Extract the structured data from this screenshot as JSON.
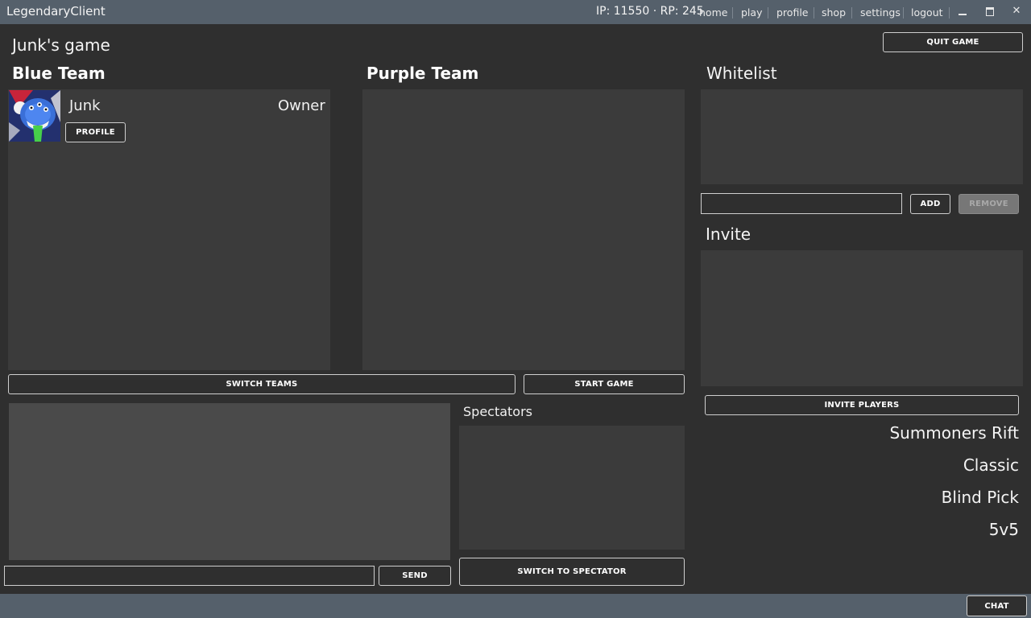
{
  "app": {
    "title": "LegendaryClient"
  },
  "header": {
    "currency": "IP: 11550 · RP: 245",
    "nav": [
      "home",
      "play",
      "profile",
      "shop",
      "settings",
      "logout"
    ],
    "window": {
      "minimize": "",
      "maximize": "",
      "close": "✕"
    }
  },
  "lobby": {
    "title": "Junk's game",
    "quit_label": "QUIT GAME",
    "blue_team": {
      "title": "Blue Team",
      "players": [
        {
          "name": "Junk",
          "role": "Owner",
          "profile_label": "PROFILE"
        }
      ]
    },
    "purple_team": {
      "title": "Purple Team"
    },
    "switch_teams_label": "SWITCH TEAMS",
    "start_game_label": "START GAME"
  },
  "whitelist": {
    "title": "Whitelist",
    "input_value": "",
    "add_label": "ADD",
    "remove_label": "REMOVE"
  },
  "invite": {
    "title": "Invite",
    "invite_label": "INVITE PLAYERS"
  },
  "game_info": {
    "map": "Summoners Rift",
    "mode": "Classic",
    "pick": "Blind Pick",
    "size": "5v5"
  },
  "chat": {
    "input_value": "",
    "send_label": "SEND"
  },
  "spectators": {
    "title": "Spectators",
    "switch_label": "SWITCH TO SPECTATOR"
  },
  "footer": {
    "chat_label": "CHAT"
  },
  "colors": {
    "background": "#2f2f2f",
    "bar": "#55606b",
    "panel": "#3b3b3b",
    "chat_panel": "#4a4a4a"
  }
}
